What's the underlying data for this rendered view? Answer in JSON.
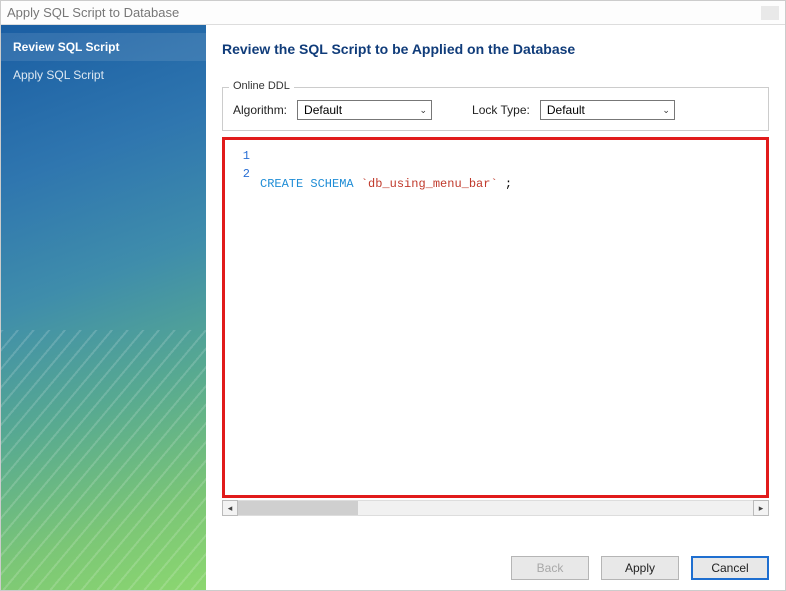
{
  "window": {
    "title": "Apply SQL Script to Database"
  },
  "sidebar": {
    "items": [
      {
        "label": "Review SQL Script",
        "active": true
      },
      {
        "label": "Apply SQL Script",
        "active": false
      }
    ]
  },
  "main": {
    "heading": "Review the SQL Script to be Applied on the Database",
    "onlineDDL": {
      "legend": "Online DDL",
      "algorithm": {
        "label": "Algorithm:",
        "value": "Default"
      },
      "lockType": {
        "label": "Lock Type:",
        "value": "Default"
      }
    },
    "sql": {
      "lines": [
        {
          "num": "1",
          "kw": "CREATE SCHEMA",
          "arg": "`db_using_menu_bar`",
          "tail": " ;"
        },
        {
          "num": "2",
          "kw": "",
          "arg": "",
          "tail": ""
        }
      ]
    }
  },
  "buttons": {
    "back": "Back",
    "apply": "Apply",
    "cancel": "Cancel"
  }
}
